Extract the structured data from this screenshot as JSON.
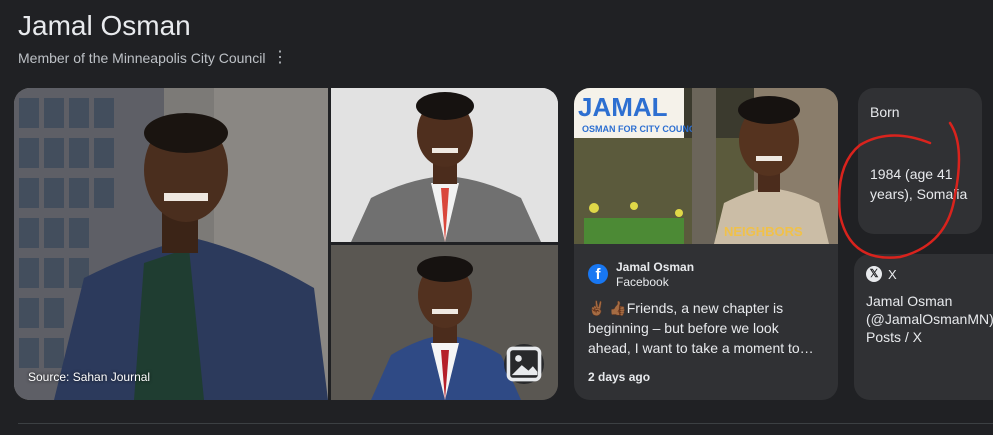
{
  "header": {
    "title": "Jamal Osman",
    "subtitle": "Member of the Minneapolis City Council"
  },
  "photos": {
    "source_label": "Source: Sahan Journal"
  },
  "facebook_card": {
    "author": "Jamal Osman",
    "platform": "Facebook",
    "text": "✌🏾 👍🏾Friends, a new chapter is beginning – but before we look ahead, I want to take a moment to…",
    "time": "2 days ago"
  },
  "born_card": {
    "label": "Born",
    "value": "1984 (age 41 years), Somalia"
  },
  "x_card": {
    "platform": "X",
    "title": "Jamal Osman (@JamalOsmanMN) / Posts / X"
  },
  "colors": {
    "background": "#202124",
    "card": "#303134",
    "annotation": "#d9231d",
    "facebook": "#1877f2"
  }
}
